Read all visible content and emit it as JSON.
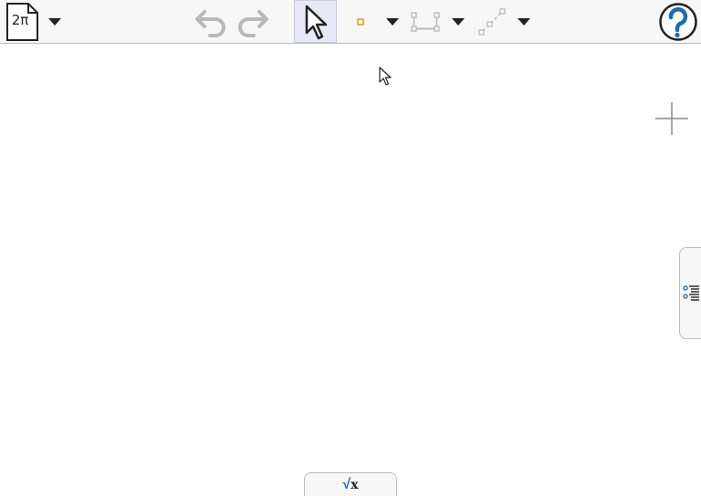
{
  "toolbar": {
    "file_icon_label": "2π",
    "icons": {
      "file": "file-graphing-icon",
      "undo": "undo-icon",
      "redo": "redo-icon",
      "move": "move-pointer-icon",
      "point": "point-icon",
      "segment": "segment-icon",
      "line": "line-icon",
      "help": "help-icon"
    },
    "colors": {
      "active_bg": "#e8e8f6",
      "point_accent": "#e69e17",
      "help_blue": "#1b6bb5",
      "disabled": "#b8b8b8"
    }
  },
  "canvas": {
    "fullscreen_icon": "plus-icon"
  },
  "side_tab": {
    "icon": "algebra-view-icon"
  },
  "input_bar": {
    "sqrt_symbol": "√",
    "variable": "x",
    "icon": "input-bar-sqrt-icon"
  }
}
